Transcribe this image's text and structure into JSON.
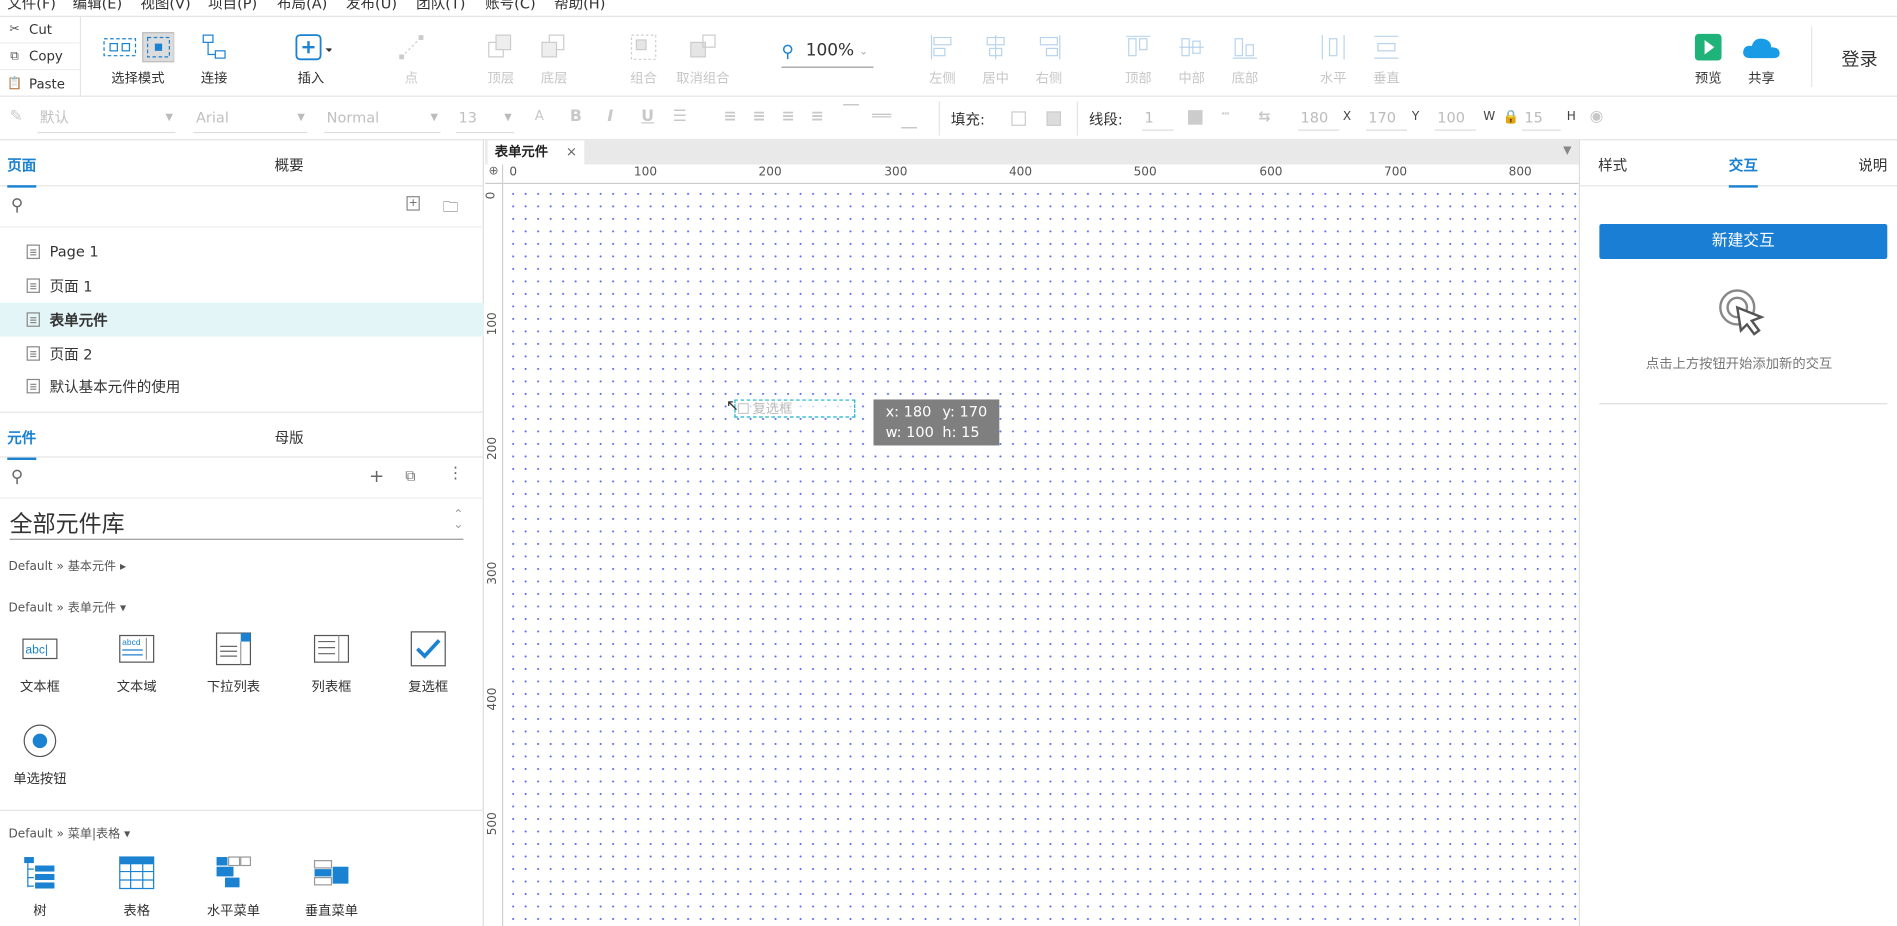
{
  "menubar": {
    "items": [
      "文件(F)",
      "编辑(E)",
      "视图(V)",
      "项目(P)",
      "布局(A)",
      "发布(U)",
      "团队(T)",
      "账号(C)",
      "帮助(H)"
    ]
  },
  "clipboard": {
    "cut": "Cut",
    "copy": "Copy",
    "paste": "Paste"
  },
  "toolbar": {
    "select_mode": "选择模式",
    "connect": "连接",
    "insert": "插入",
    "point": "点",
    "top_layer": "顶层",
    "bottom_layer": "底层",
    "group": "组合",
    "ungroup": "取消组合",
    "zoom": "100%",
    "align_left": "左侧",
    "align_center": "居中",
    "align_right": "右侧",
    "align_top": "顶部",
    "align_middle": "中部",
    "align_bottom": "底部",
    "dist_h": "水平",
    "dist_v": "垂直",
    "preview": "预览",
    "share": "共享",
    "login": "登录"
  },
  "formatbar": {
    "style": "默认",
    "font": "Arial",
    "weight": "Normal",
    "size": "13",
    "fill_label": "填充:",
    "line_label": "线段:",
    "line_width": "1",
    "x": "180",
    "x_label": "X",
    "y": "170",
    "y_label": "Y",
    "w": "100",
    "w_label": "W",
    "h": "15",
    "h_label": "H"
  },
  "left": {
    "tab_pages": "页面",
    "tab_outline": "概要",
    "pages": [
      "Page 1",
      "页面 1",
      "表单元件",
      "页面 2",
      "默认基本元件的使用"
    ],
    "tab_widgets": "元件",
    "tab_masters": "母版",
    "library": "全部元件库",
    "groups": [
      "Default » 基本元件 ▸",
      "Default » 表单元件 ▾",
      "Default » 菜单|表格 ▾"
    ],
    "form_widgets": [
      "文本框",
      "文本域",
      "下拉列表",
      "列表框",
      "复选框",
      "单选按钮"
    ],
    "menu_widgets": [
      "树",
      "表格",
      "水平菜单",
      "垂直菜单"
    ]
  },
  "canvas": {
    "tab": "表单元件",
    "ruler_top": [
      "0",
      "100",
      "200",
      "300",
      "400",
      "500",
      "600",
      "700",
      "800"
    ],
    "ruler_left": [
      "0",
      "100",
      "200",
      "300",
      "400",
      "500"
    ],
    "checkbox_label": "复选框",
    "tooltip_line1_x": "x: 180",
    "tooltip_line1_y": "y: 170",
    "tooltip_line2_w": "w: 100",
    "tooltip_line2_h": "h: 15"
  },
  "right": {
    "tab_style": "样式",
    "tab_interaction": "交互",
    "tab_notes": "说明",
    "new_interaction": "新建交互",
    "hint": "点击上方按钮开始添加新的交互"
  },
  "colors": {
    "accent": "#1a7fd4",
    "preview_green": "#1fb37a",
    "share_blue": "#1a9be6"
  }
}
